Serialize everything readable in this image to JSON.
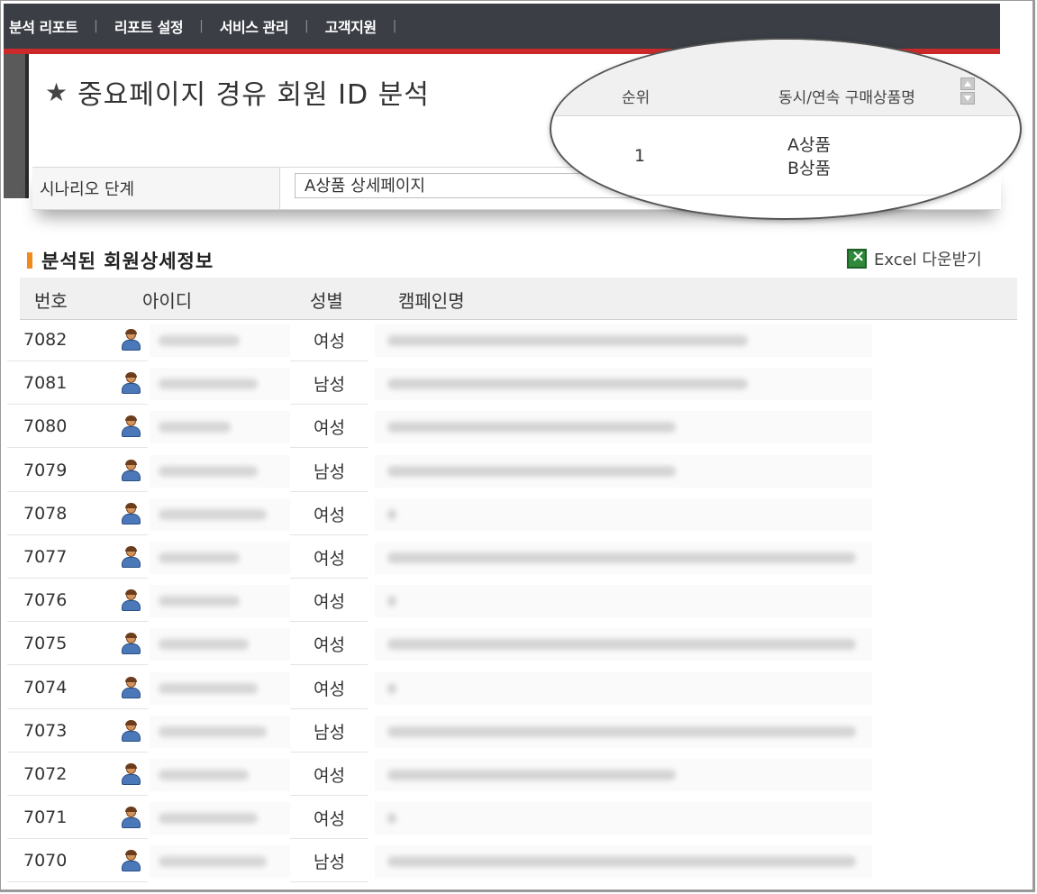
{
  "nav": {
    "items": [
      "분석 리포트",
      "리포트 설정",
      "서비스 관리",
      "고객지원"
    ]
  },
  "page_title": "중요페이지 경유 회원 ID 분석",
  "scenario": {
    "label": "시나리오 단계",
    "value": "A상품 상세페이지"
  },
  "popup": {
    "col_rank": "순위",
    "col_product": "동시/연속 구매상품명",
    "rank": "1",
    "product_line1": "A상품",
    "product_line2": "B상품"
  },
  "section_title": "분석된 회원상세정보",
  "excel_label": "Excel 다운받기",
  "table": {
    "headers": {
      "no": "번호",
      "id": "아이디",
      "gender": "성별",
      "campaign": "캠페인명"
    },
    "rows": [
      {
        "no": "7082",
        "gender": "여성"
      },
      {
        "no": "7081",
        "gender": "남성"
      },
      {
        "no": "7080",
        "gender": "여성"
      },
      {
        "no": "7079",
        "gender": "남성"
      },
      {
        "no": "7078",
        "gender": "여성"
      },
      {
        "no": "7077",
        "gender": "여성"
      },
      {
        "no": "7076",
        "gender": "여성"
      },
      {
        "no": "7075",
        "gender": "여성"
      },
      {
        "no": "7074",
        "gender": "여성"
      },
      {
        "no": "7073",
        "gender": "남성"
      },
      {
        "no": "7072",
        "gender": "여성"
      },
      {
        "no": "7071",
        "gender": "여성"
      },
      {
        "no": "7070",
        "gender": "남성"
      }
    ]
  },
  "colors": {
    "nav_bg": "#3b3e45",
    "accent_red": "#cc2a2a",
    "section_bar": "#f08a1c",
    "excel_green": "#2e8a3a"
  }
}
